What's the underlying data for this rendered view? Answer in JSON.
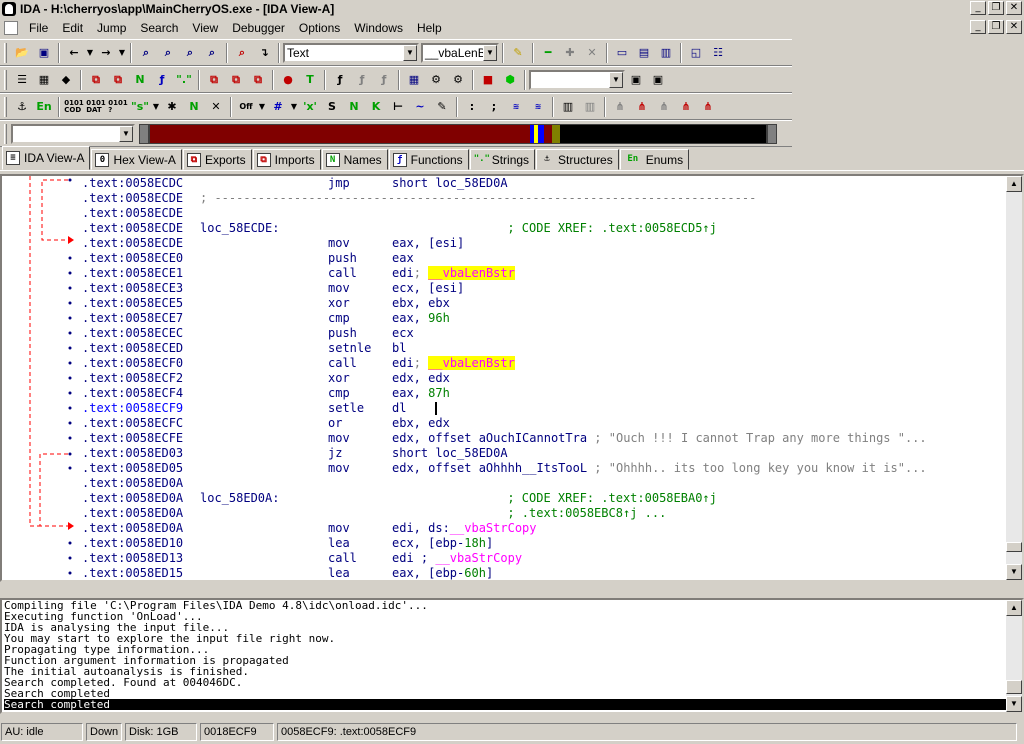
{
  "window": {
    "title": "IDA - H:\\cherryos\\app\\MainCherryOS.exe - [IDA View-A]"
  },
  "menu": [
    "File",
    "Edit",
    "Jump",
    "Search",
    "View",
    "Debugger",
    "Options",
    "Windows",
    "Help"
  ],
  "toolbar": {
    "segment_combo": "Text",
    "name_combo": "__vbaLenB",
    "search_combo": "",
    "extra_combo": ""
  },
  "tabs": [
    {
      "label": "IDA View-A",
      "icon": "ida-view-icon"
    },
    {
      "label": "Hex View-A",
      "icon": "hex-view-icon"
    },
    {
      "label": "Exports",
      "icon": "exports-icon"
    },
    {
      "label": "Imports",
      "icon": "imports-icon"
    },
    {
      "label": "Names",
      "icon": "names-icon"
    },
    {
      "label": "Functions",
      "icon": "functions-icon"
    },
    {
      "label": "Strings",
      "icon": "strings-icon"
    },
    {
      "label": "Structures",
      "icon": "structures-icon"
    },
    {
      "label": "Enums",
      "icon": "enums-icon"
    }
  ],
  "code": {
    "lines": [
      {
        "addr": ".text:0058ECDC",
        "label": "",
        "mn": "jmp",
        "ops": "short loc_58ED0A",
        "comment": ""
      },
      {
        "addr": ".text:0058ECDE",
        "label": "",
        "mn": "",
        "ops": "",
        "comment": "",
        "separator": "; ---------------------------------------------------------------------------"
      },
      {
        "addr": ".text:0058ECDE",
        "label": "",
        "mn": "",
        "ops": "",
        "comment": ""
      },
      {
        "addr": ".text:0058ECDE",
        "label": "loc_58ECDE:",
        "mn": "",
        "ops": "",
        "comment": "",
        "xref": "; CODE XREF: .text:0058ECD5↑j"
      },
      {
        "addr": ".text:0058ECDE",
        "label": "",
        "mn": "mov",
        "ops": "eax, [esi]",
        "comment": ""
      },
      {
        "addr": ".text:0058ECE0",
        "label": "",
        "mn": "push",
        "ops": "eax",
        "comment": ""
      },
      {
        "addr": ".text:0058ECE1",
        "label": "",
        "mn": "call",
        "ops": "edi",
        "comment": "; ",
        "import": "__vbaLenBstr"
      },
      {
        "addr": ".text:0058ECE3",
        "label": "",
        "mn": "mov",
        "ops": "ecx, [esi]",
        "comment": ""
      },
      {
        "addr": ".text:0058ECE5",
        "label": "",
        "mn": "xor",
        "ops": "ebx, ebx",
        "comment": ""
      },
      {
        "addr": ".text:0058ECE7",
        "label": "",
        "mn": "cmp",
        "ops": "eax, ",
        "num": "96h",
        "comment": ""
      },
      {
        "addr": ".text:0058ECEC",
        "label": "",
        "mn": "push",
        "ops": "ecx",
        "comment": ""
      },
      {
        "addr": ".text:0058ECED",
        "label": "",
        "mn": "setnle",
        "ops": "bl",
        "comment": ""
      },
      {
        "addr": ".text:0058ECF0",
        "label": "",
        "mn": "call",
        "ops": "edi",
        "comment": "; ",
        "import": "__vbaLenBstr"
      },
      {
        "addr": ".text:0058ECF2",
        "label": "",
        "mn": "xor",
        "ops": "edx, edx",
        "comment": ""
      },
      {
        "addr": ".text:0058ECF4",
        "label": "",
        "mn": "cmp",
        "ops": "eax, ",
        "num": "87h",
        "comment": ""
      },
      {
        "addr": ".text:0058ECF9",
        "label": "",
        "mn": "setle",
        "ops": "dl",
        "comment": "",
        "current": true
      },
      {
        "addr": ".text:0058ECFC",
        "label": "",
        "mn": "or",
        "ops": "ebx, edx",
        "comment": ""
      },
      {
        "addr": ".text:0058ECFE",
        "label": "",
        "mn": "mov",
        "ops": "edx, offset aOuchICannotTra",
        "comment": " ; \"Ouch !!! I cannot Trap any more things \"..."
      },
      {
        "addr": ".text:0058ED03",
        "label": "",
        "mn": "jz",
        "ops": "short loc_58ED0A",
        "comment": ""
      },
      {
        "addr": ".text:0058ED05",
        "label": "",
        "mn": "mov",
        "ops": "edx, offset aOhhhh__ItsTooL",
        "comment": " ; \"Ohhhh.. its too long key you know it is\"..."
      },
      {
        "addr": ".text:0058ED0A",
        "label": "",
        "mn": "",
        "ops": "",
        "comment": ""
      },
      {
        "addr": ".text:0058ED0A",
        "label": "loc_58ED0A:",
        "mn": "",
        "ops": "",
        "comment": "",
        "xref": "; CODE XREF: .text:0058EBA0↑j"
      },
      {
        "addr": ".text:0058ED0A",
        "label": "",
        "mn": "",
        "ops": "",
        "comment": "",
        "xref": "; .text:0058EBC8↑j ..."
      },
      {
        "addr": ".text:0058ED0A",
        "label": "",
        "mn": "mov",
        "ops": "edi, ds:",
        "fn": "__vbaStrCopy",
        "comment": ""
      },
      {
        "addr": ".text:0058ED10",
        "label": "",
        "mn": "lea",
        "ops": "ecx, [ebp-",
        "num": "18h",
        "tail": "]",
        "comment": ""
      },
      {
        "addr": ".text:0058ED13",
        "label": "",
        "mn": "call",
        "ops": "edi ; ",
        "fn": "__vbaStrCopy",
        "comment": ""
      },
      {
        "addr": ".text:0058ED15",
        "label": "",
        "mn": "lea",
        "ops": "eax, [ebp-",
        "num": "60h",
        "tail": "]",
        "comment": ""
      }
    ]
  },
  "output": {
    "lines": [
      "Compiling file 'C:\\Program Files\\IDA Demo 4.8\\idc\\onload.idc'...",
      "Executing function 'OnLoad'...",
      "IDA is analysing the input file...",
      "You may start to explore the input file right now.",
      "Propagating type information...",
      "Function argument information is propagated",
      "The initial autoanalysis is finished.",
      "Search completed. Found at 004046DC.",
      "Search completed",
      "Search completed"
    ]
  },
  "status": {
    "state": "AU:  idle",
    "direction": "Down",
    "disk": "Disk: 1GB",
    "offset": "0018ECF9",
    "location": "0058ECF9: .text:0058ECF9"
  },
  "colors": {
    "address": "#000080",
    "comment": "#808080",
    "xref": "#008000",
    "import_bg": "#ffff00",
    "import_fg": "#ff00ff"
  }
}
